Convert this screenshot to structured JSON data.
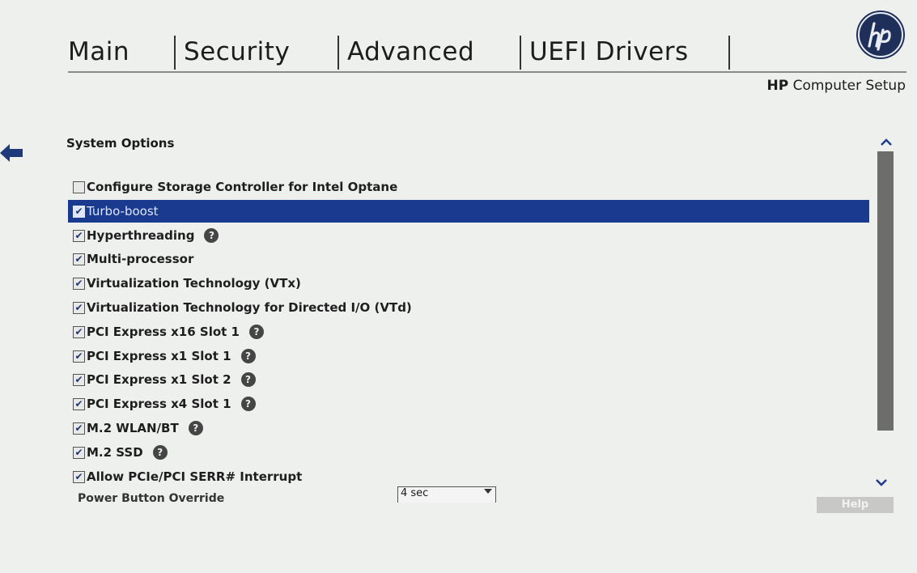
{
  "tabs": [
    {
      "label": "Main"
    },
    {
      "label": "Security"
    },
    {
      "label": "Advanced"
    },
    {
      "label": "UEFI Drivers"
    }
  ],
  "brand": {
    "bold": "HP",
    "rest": " Computer Setup"
  },
  "section_title": "System Options",
  "options": [
    {
      "label": "Configure Storage Controller for Intel Optane",
      "checked": false,
      "help": false
    },
    {
      "label": "Turbo-boost",
      "checked": true,
      "help": false,
      "selected": true
    },
    {
      "label": "Hyperthreading",
      "checked": true,
      "help": true
    },
    {
      "label": "Multi-processor",
      "checked": true,
      "help": false
    },
    {
      "label": "Virtualization Technology (VTx)",
      "checked": true,
      "help": false
    },
    {
      "label": "Virtualization Technology for Directed I/O (VTd)",
      "checked": true,
      "help": false
    },
    {
      "label": "PCI Express x16 Slot 1",
      "checked": true,
      "help": true
    },
    {
      "label": "PCI Express x1 Slot 1",
      "checked": true,
      "help": true
    },
    {
      "label": "PCI Express x1 Slot 2",
      "checked": true,
      "help": true
    },
    {
      "label": "PCI Express x4 Slot 1",
      "checked": true,
      "help": true
    },
    {
      "label": "M.2 WLAN/BT",
      "checked": true,
      "help": true
    },
    {
      "label": "M.2 SSD",
      "checked": true,
      "help": true
    },
    {
      "label": "Allow PCIe/PCI SERR# Interrupt",
      "checked": true,
      "help": false
    }
  ],
  "power_button_override": {
    "label": "Power Button Override",
    "value": "4 sec"
  },
  "help_button": "Help",
  "help_glyph": "?",
  "colors": {
    "selected_row": "#1a3a8f",
    "background": "#eef0ee",
    "logo": "#1e2f5a"
  }
}
